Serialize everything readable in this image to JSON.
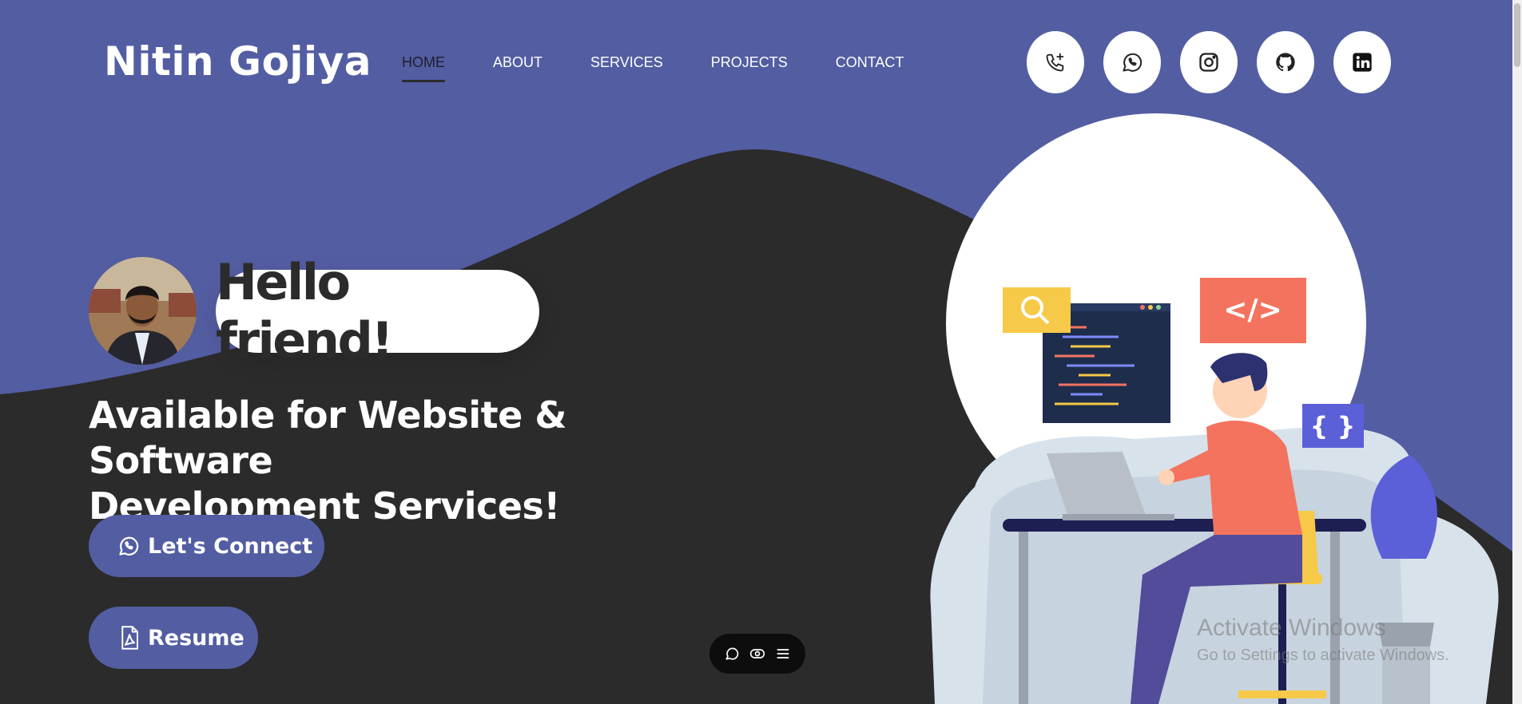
{
  "header": {
    "brand": "Nitin Gojiya",
    "nav": [
      {
        "label": "HOME",
        "active": true
      },
      {
        "label": "ABOUT"
      },
      {
        "label": "SERVICES"
      },
      {
        "label": "PROJECTS"
      },
      {
        "label": "CONTACT"
      }
    ],
    "social": [
      {
        "icon": "phone-plus-icon"
      },
      {
        "icon": "whatsapp-icon"
      },
      {
        "icon": "instagram-icon"
      },
      {
        "icon": "github-icon"
      },
      {
        "icon": "linkedin-icon"
      }
    ]
  },
  "hero": {
    "greeting": "Hello friend!",
    "tagline_line1": "Available for Website & Software",
    "tagline_line2": "Development Services!",
    "connect_label": "Let's Connect",
    "resume_label": "Resume"
  },
  "toolbar": {
    "items": [
      "chat-icon",
      "eye-icon",
      "menu-icon"
    ]
  },
  "watermark": {
    "line1": "Activate Windows",
    "line2": "Go to Settings to activate Windows."
  },
  "colors": {
    "primary": "#535da1",
    "dark": "#2b2b2b",
    "white": "#ffffff",
    "accent_orange": "#f4735e",
    "accent_yellow": "#f7c948"
  }
}
